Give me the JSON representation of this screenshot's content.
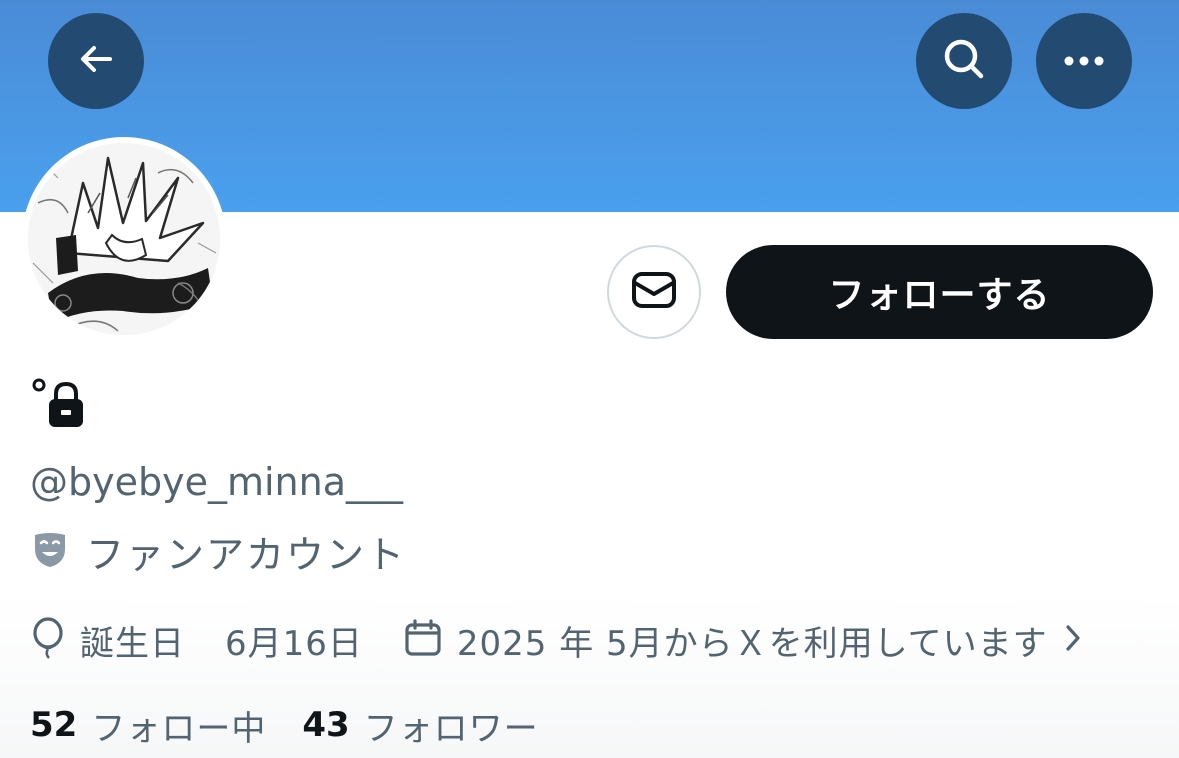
{
  "header": {
    "back_icon": "arrow-left-icon",
    "search_icon": "search-icon",
    "more_icon": "more-horizontal-icon",
    "banner_color": "#4a97e3",
    "button_bg": "#234b72"
  },
  "profile": {
    "avatar_icon": "avatar-manga-illustration",
    "name_icon": "lock-icon",
    "handle": "@byebye_minna___",
    "category_icon": "theater-mask-icon",
    "category": "ファンアカウント"
  },
  "actions": {
    "message_icon": "envelope-icon",
    "follow_label": "フォローする"
  },
  "meta": {
    "birthday_icon": "balloon-icon",
    "birthday_label": "誕生日",
    "birthday_value": "6月16日",
    "joined_icon": "calendar-icon",
    "joined_text": "2025 年 5月からＸを利用しています",
    "joined_chevron_icon": "chevron-right-icon"
  },
  "stats": {
    "following_count": "52",
    "following_label": "フォロー中",
    "followers_count": "43",
    "followers_label": "フォロワー"
  },
  "colors": {
    "text_primary": "#0f1419",
    "text_secondary": "#536471",
    "border": "#cfd9de"
  }
}
